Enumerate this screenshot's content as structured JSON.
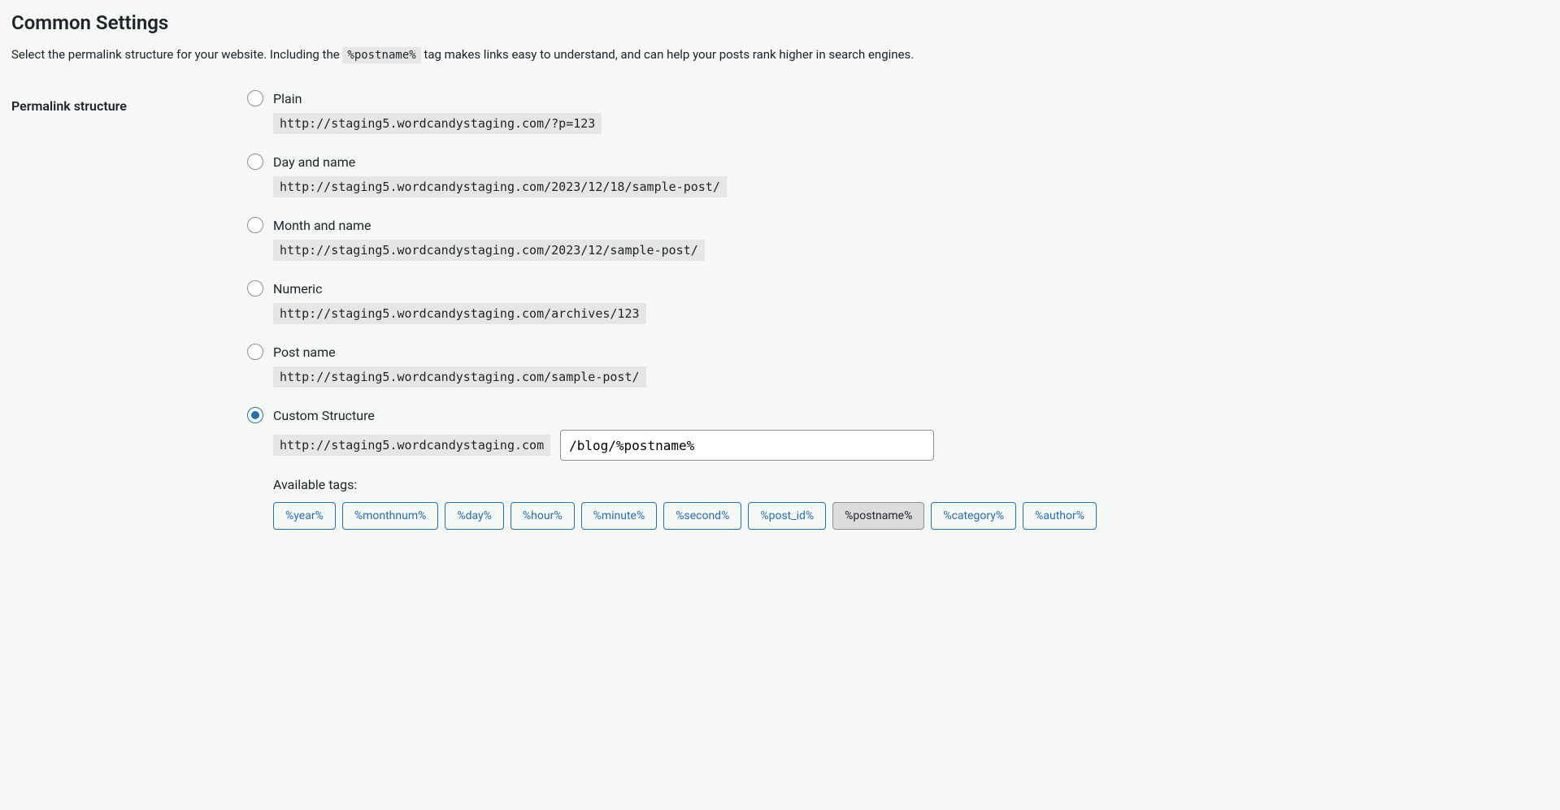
{
  "heading": "Common Settings",
  "description": {
    "before": "Select the permalink structure for your website. Including the ",
    "code": "%postname%",
    "after": " tag makes links easy to understand, and can help your posts rank higher in search engines."
  },
  "structure_label": "Permalink structure",
  "options": {
    "plain": {
      "label": "Plain",
      "url": "http://staging5.wordcandystaging.com/?p=123"
    },
    "day_name": {
      "label": "Day and name",
      "url": "http://staging5.wordcandystaging.com/2023/12/18/sample-post/"
    },
    "month_name": {
      "label": "Month and name",
      "url": "http://staging5.wordcandystaging.com/2023/12/sample-post/"
    },
    "numeric": {
      "label": "Numeric",
      "url": "http://staging5.wordcandystaging.com/archives/123"
    },
    "post_name": {
      "label": "Post name",
      "url": "http://staging5.wordcandystaging.com/sample-post/"
    },
    "custom": {
      "label": "Custom Structure",
      "base_url": "http://staging5.wordcandystaging.com",
      "value": "/blog/%postname%"
    }
  },
  "available_tags_label": "Available tags:",
  "tags": {
    "year": "%year%",
    "monthnum": "%monthnum%",
    "day": "%day%",
    "hour": "%hour%",
    "minute": "%minute%",
    "second": "%second%",
    "post_id": "%post_id%",
    "postname": "%postname%",
    "category": "%category%",
    "author": "%author%"
  }
}
